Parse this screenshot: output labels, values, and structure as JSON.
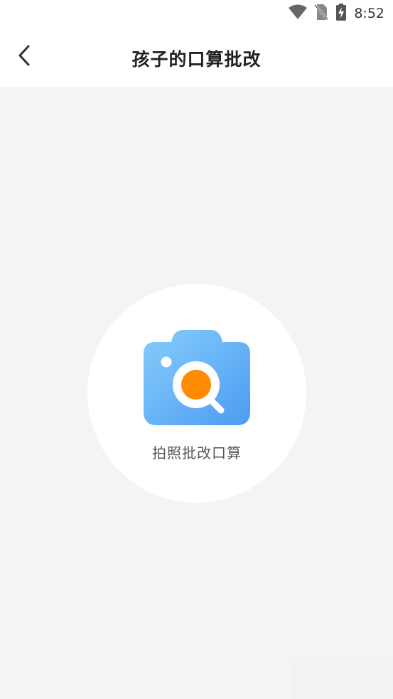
{
  "status_bar": {
    "time": "8:52",
    "icons": [
      "wifi-icon",
      "no-sim-icon",
      "battery-charging-icon"
    ]
  },
  "nav": {
    "back_icon": "chevron-left-icon",
    "title": "孩子的口算批改"
  },
  "main": {
    "capture_button": {
      "icon": "camera-search-icon",
      "label": "拍照批改口算"
    }
  },
  "colors": {
    "background": "#f4f4f4",
    "camera_blue": "#5aaaf5",
    "lens_orange": "#ff8c00",
    "title_text": "#222222",
    "label_text": "#555555"
  }
}
